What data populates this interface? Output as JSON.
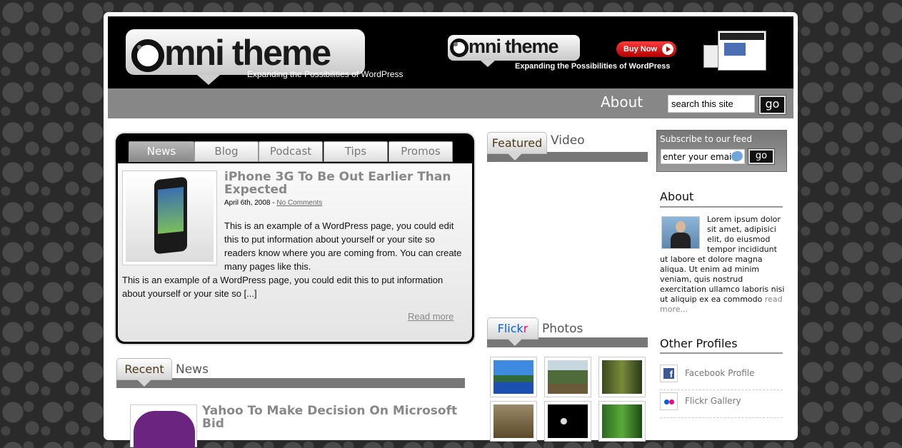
{
  "header": {
    "logo_prefix": "mni",
    "logo_main": "theme",
    "tagline": "Expanding the Possibilities of WordPress",
    "banner_logo_prefix": "mni",
    "banner_logo_main": "theme",
    "banner_tagline": "Expanding the Possibilities of WordPress",
    "buy_now_label": "Buy Now"
  },
  "nav": {
    "about_label": "About",
    "search_value": "search this site",
    "go_label": "go"
  },
  "tabs": [
    {
      "label": "News",
      "active": true
    },
    {
      "label": "Blog",
      "active": false
    },
    {
      "label": "Podcast",
      "active": false
    },
    {
      "label": "Tips",
      "active": false
    },
    {
      "label": "Promos",
      "active": false
    }
  ],
  "featured_post": {
    "title": "iPhone 3G To Be Out Earlier Than Expected",
    "date": "April 6th, 2008",
    "separator": " - ",
    "comments_link": "No Comments",
    "excerpt_wrapped": "This is an example of a WordPress page, you could edit this to put information about yourself or your site so readers know where you are coming from. You can create many pages like this.",
    "excerpt_full": "This is an example of a WordPress page, you could edit this to put information about yourself or your site so [...]",
    "read_more": "Read more"
  },
  "recent": {
    "tab_label": "Recent",
    "label": "News",
    "first_title": "Yahoo To Make Decision On Microsoft Bid"
  },
  "featured_video": {
    "tab_label": "Featured",
    "label": "Video"
  },
  "flickr": {
    "tab_label_a": "Flick",
    "tab_label_b": "r",
    "label": "Photos"
  },
  "subscribe": {
    "title": "Subscribe to our feed",
    "email_value": "enter your email",
    "go_label": "go"
  },
  "about": {
    "heading": "About",
    "text": "Lorem ipsum dolor sit amet, adipisici elit, do eiusmod tempor incididunt ut labore et dolore magna aliqua. Ut enim ad minim veniam, quis nostrud exercitation ullamco laboris nisi ut aliquip ex ea commodo consequat.",
    "text_visible": "Lorem ipsum dolor sit amet, adipisici elit, do eiusmod tempor incididunt ut labore et dolore magna aliqua. Ut enim ad minim veniam, quis nostrud exercitation ullamco laboris nisi ut aliquip ex ea commodo",
    "read_more": "read more..."
  },
  "profiles": {
    "heading": "Other Profiles",
    "items": [
      {
        "label": "Facebook Profile",
        "icon": "facebook-icon"
      },
      {
        "label": "Flickr Gallery",
        "icon": "flickr-icon"
      }
    ]
  },
  "colors": {
    "nav_bar": "#878787",
    "header_bg": "#000000",
    "flickr_blue": "#0063dc",
    "flickr_pink": "#ff0084"
  }
}
